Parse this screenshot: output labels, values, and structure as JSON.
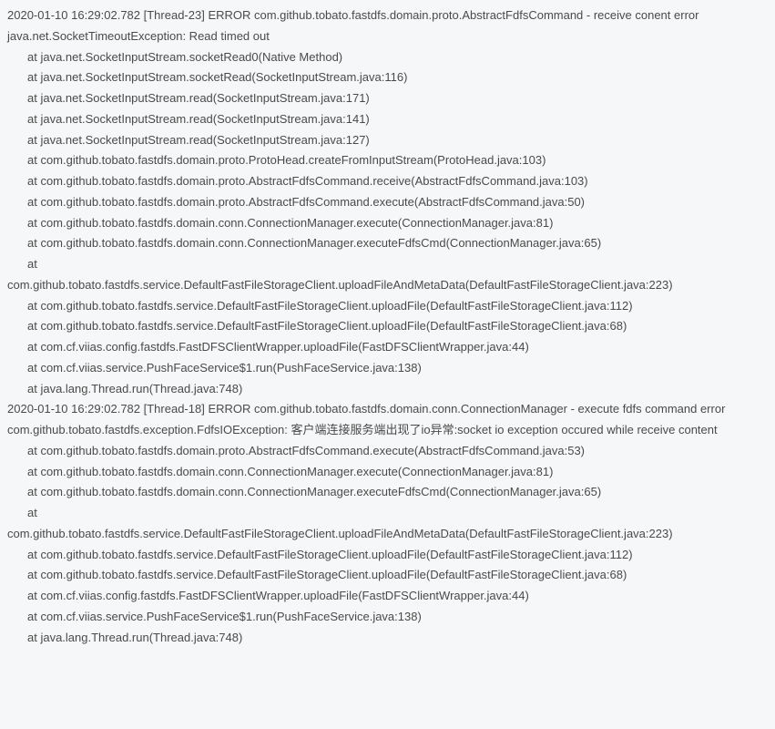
{
  "log1": {
    "header": "2020-01-10 16:29:02.782 [Thread-23] ERROR com.github.tobato.fastdfs.domain.proto.AbstractFdfsCommand - receive conent error",
    "exception": "java.net.SocketTimeoutException: Read timed out",
    "stack": [
      "at java.net.SocketInputStream.socketRead0(Native Method)",
      "at java.net.SocketInputStream.socketRead(SocketInputStream.java:116)",
      "at java.net.SocketInputStream.read(SocketInputStream.java:171)",
      "at java.net.SocketInputStream.read(SocketInputStream.java:141)",
      "at java.net.SocketInputStream.read(SocketInputStream.java:127)",
      "at com.github.tobato.fastdfs.domain.proto.ProtoHead.createFromInputStream(ProtoHead.java:103)",
      "at com.github.tobato.fastdfs.domain.proto.AbstractFdfsCommand.receive(AbstractFdfsCommand.java:103)",
      "at com.github.tobato.fastdfs.domain.proto.AbstractFdfsCommand.execute(AbstractFdfsCommand.java:50)",
      "at com.github.tobato.fastdfs.domain.conn.ConnectionManager.execute(ConnectionManager.java:81)",
      "at com.github.tobato.fastdfs.domain.conn.ConnectionManager.executeFdfsCmd(ConnectionManager.java:65)"
    ],
    "at_label": "at",
    "wrapped": "com.github.tobato.fastdfs.service.DefaultFastFileStorageClient.uploadFileAndMetaData(DefaultFastFileStorageClient.java:223)",
    "stack2": [
      "at com.github.tobato.fastdfs.service.DefaultFastFileStorageClient.uploadFile(DefaultFastFileStorageClient.java:112)",
      "at com.github.tobato.fastdfs.service.DefaultFastFileStorageClient.uploadFile(DefaultFastFileStorageClient.java:68)",
      "at com.cf.viias.config.fastdfs.FastDFSClientWrapper.uploadFile(FastDFSClientWrapper.java:44)",
      "at com.cf.viias.service.PushFaceService$1.run(PushFaceService.java:138)",
      "at java.lang.Thread.run(Thread.java:748)"
    ]
  },
  "log2": {
    "header": "2020-01-10 16:29:02.782 [Thread-18] ERROR com.github.tobato.fastdfs.domain.conn.ConnectionManager - execute fdfs command error",
    "exception": "com.github.tobato.fastdfs.exception.FdfsIOException: 客户端连接服务端出现了io异常:socket io exception occured while receive content",
    "stack": [
      "at com.github.tobato.fastdfs.domain.proto.AbstractFdfsCommand.execute(AbstractFdfsCommand.java:53)",
      "at com.github.tobato.fastdfs.domain.conn.ConnectionManager.execute(ConnectionManager.java:81)",
      "at com.github.tobato.fastdfs.domain.conn.ConnectionManager.executeFdfsCmd(ConnectionManager.java:65)"
    ],
    "at_label": "at",
    "wrapped": "com.github.tobato.fastdfs.service.DefaultFastFileStorageClient.uploadFileAndMetaData(DefaultFastFileStorageClient.java:223)",
    "stack2": [
      "at com.github.tobato.fastdfs.service.DefaultFastFileStorageClient.uploadFile(DefaultFastFileStorageClient.java:112)",
      "at com.github.tobato.fastdfs.service.DefaultFastFileStorageClient.uploadFile(DefaultFastFileStorageClient.java:68)",
      "at com.cf.viias.config.fastdfs.FastDFSClientWrapper.uploadFile(FastDFSClientWrapper.java:44)",
      "at com.cf.viias.service.PushFaceService$1.run(PushFaceService.java:138)",
      "at java.lang.Thread.run(Thread.java:748)"
    ]
  }
}
